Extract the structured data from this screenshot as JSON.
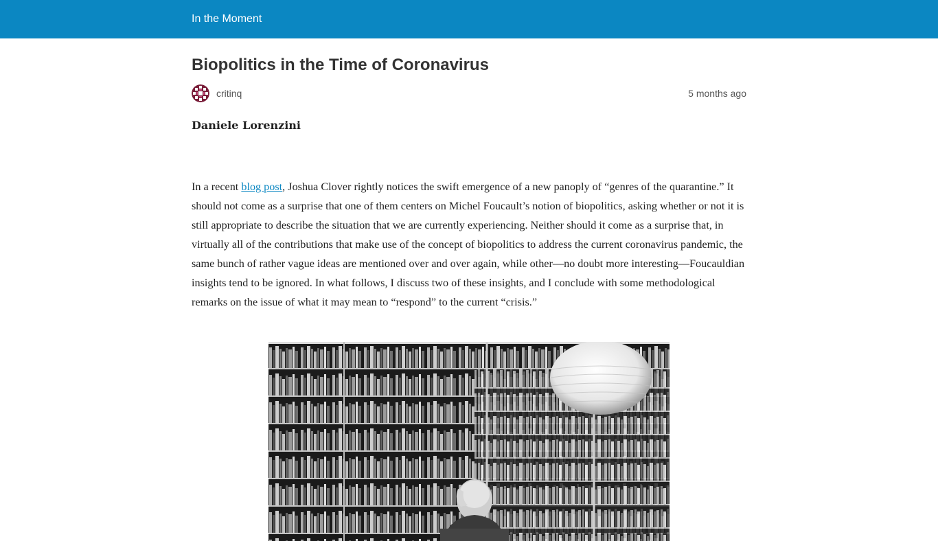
{
  "header": {
    "site_title": "In the Moment",
    "brand_color": "#0b87c2"
  },
  "post": {
    "title": "Biopolitics in the Time of Coronavirus",
    "author": "critinq",
    "date": "5 months ago",
    "byline": "Daniele Lorenzini",
    "body_intro": "In a recent ",
    "body_link": "blog post",
    "body_rest": ", Joshua Clover rightly notices the swift emergence of a new panoply of “genres of the quarantine.” It should not come as a surprise that one of them centers on Michel Foucault’s notion of biopolitics, asking whether or not it is still appropriate to describe the situation that we are currently experiencing. Neither should it come as a surprise that, in virtually all of the contributions that make use of the concept of biopolitics to address the current coronavirus pandemic, the same bunch of rather vague ideas are mentioned over and over again, while other—no doubt more interesting—Foucauldian insights tend to be ignored. In what follows, I discuss two of these insights, and I conclude with some methodological remarks on the issue of what it may mean to “respond” to the current “crisis.”"
  },
  "avatar": {
    "icon": "avatar-icon",
    "color": "#7a1e3a"
  }
}
